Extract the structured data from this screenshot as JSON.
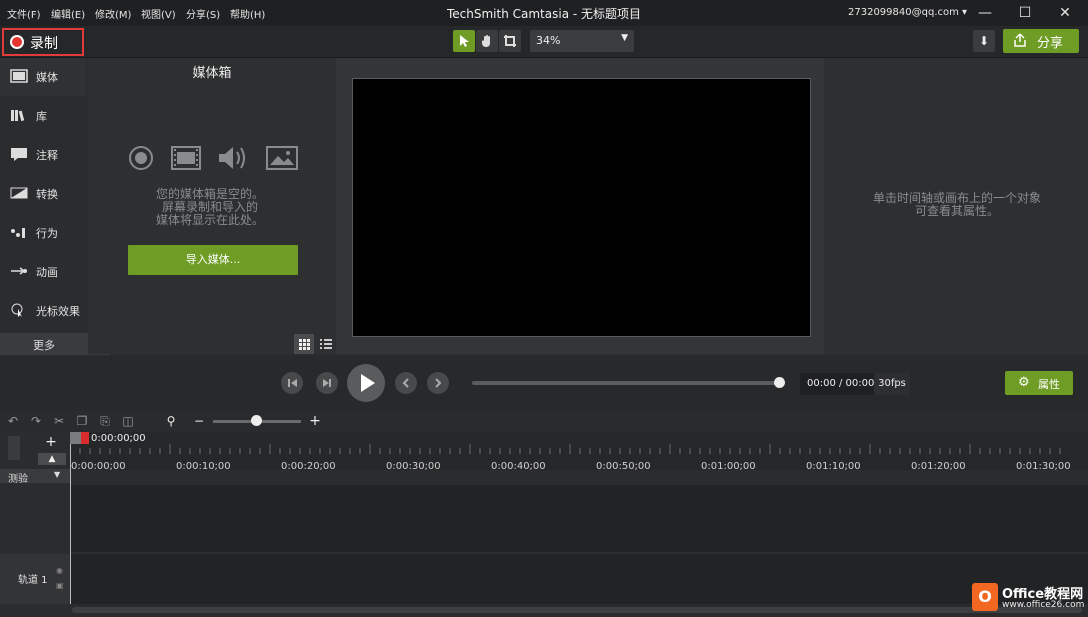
{
  "menu": [
    "文件(F)",
    "编辑(E)",
    "修改(M)",
    "视图(V)",
    "分享(S)",
    "帮助(H)"
  ],
  "app_title": "TechSmith Camtasia - 无标题项目",
  "account": "2732099840@qq.com ▾",
  "window_controls": {
    "minimize": "—",
    "maximize": "☐",
    "close": "✕"
  },
  "toolbar": {
    "record_label": "录制",
    "zoom": "34%",
    "zoom_arrow": "▼",
    "download_icon": "⬇",
    "share_label": "分享"
  },
  "sidebar": {
    "items": [
      {
        "label": "媒体",
        "icon": "film-icon"
      },
      {
        "label": "库",
        "icon": "library-icon"
      },
      {
        "label": "注释",
        "icon": "annotation-icon"
      },
      {
        "label": "转换",
        "icon": "transition-icon"
      },
      {
        "label": "行为",
        "icon": "behavior-icon"
      },
      {
        "label": "动画",
        "icon": "animation-icon"
      },
      {
        "label": "光标效果",
        "icon": "cursor-effect-icon"
      }
    ],
    "more_label": "更多",
    "add_label": "+"
  },
  "media_bin": {
    "title": "媒体箱",
    "empty_line1": "您的媒体箱是空的。",
    "empty_line2": "屏幕录制和导入的",
    "empty_line3": "媒体将显示在此处。",
    "import_label": "导入媒体..."
  },
  "properties": {
    "empty_line1": "单击时间轴或画布上的一个对象",
    "empty_line2": "可查看其属性。",
    "button_label": "属性"
  },
  "playback": {
    "time": "00:00 / 00:00",
    "fps": "30fps",
    "progress": 1.0
  },
  "timeline": {
    "playhead_time": "0:00:00;00",
    "zoom_minus": "−",
    "zoom_plus": "+",
    "zoom_level": 0.45,
    "ticks": [
      "0:00:00;00",
      "0:00:10;00",
      "0:00:20;00",
      "0:00:30;00",
      "0:00:40;00",
      "0:00:50;00",
      "0:01:00;00",
      "0:01:10;00",
      "0:01:20;00",
      "0:01:30;00"
    ],
    "track_group_label": "测验",
    "track_label": "轨道 1",
    "add_track": "+"
  },
  "watermark": {
    "logo": "O",
    "line1": "Office教程网",
    "line2": "www.office26.com"
  },
  "colors": {
    "accent": "#6f9c25",
    "record": "#e8342f",
    "background": "#2b2c2e"
  }
}
